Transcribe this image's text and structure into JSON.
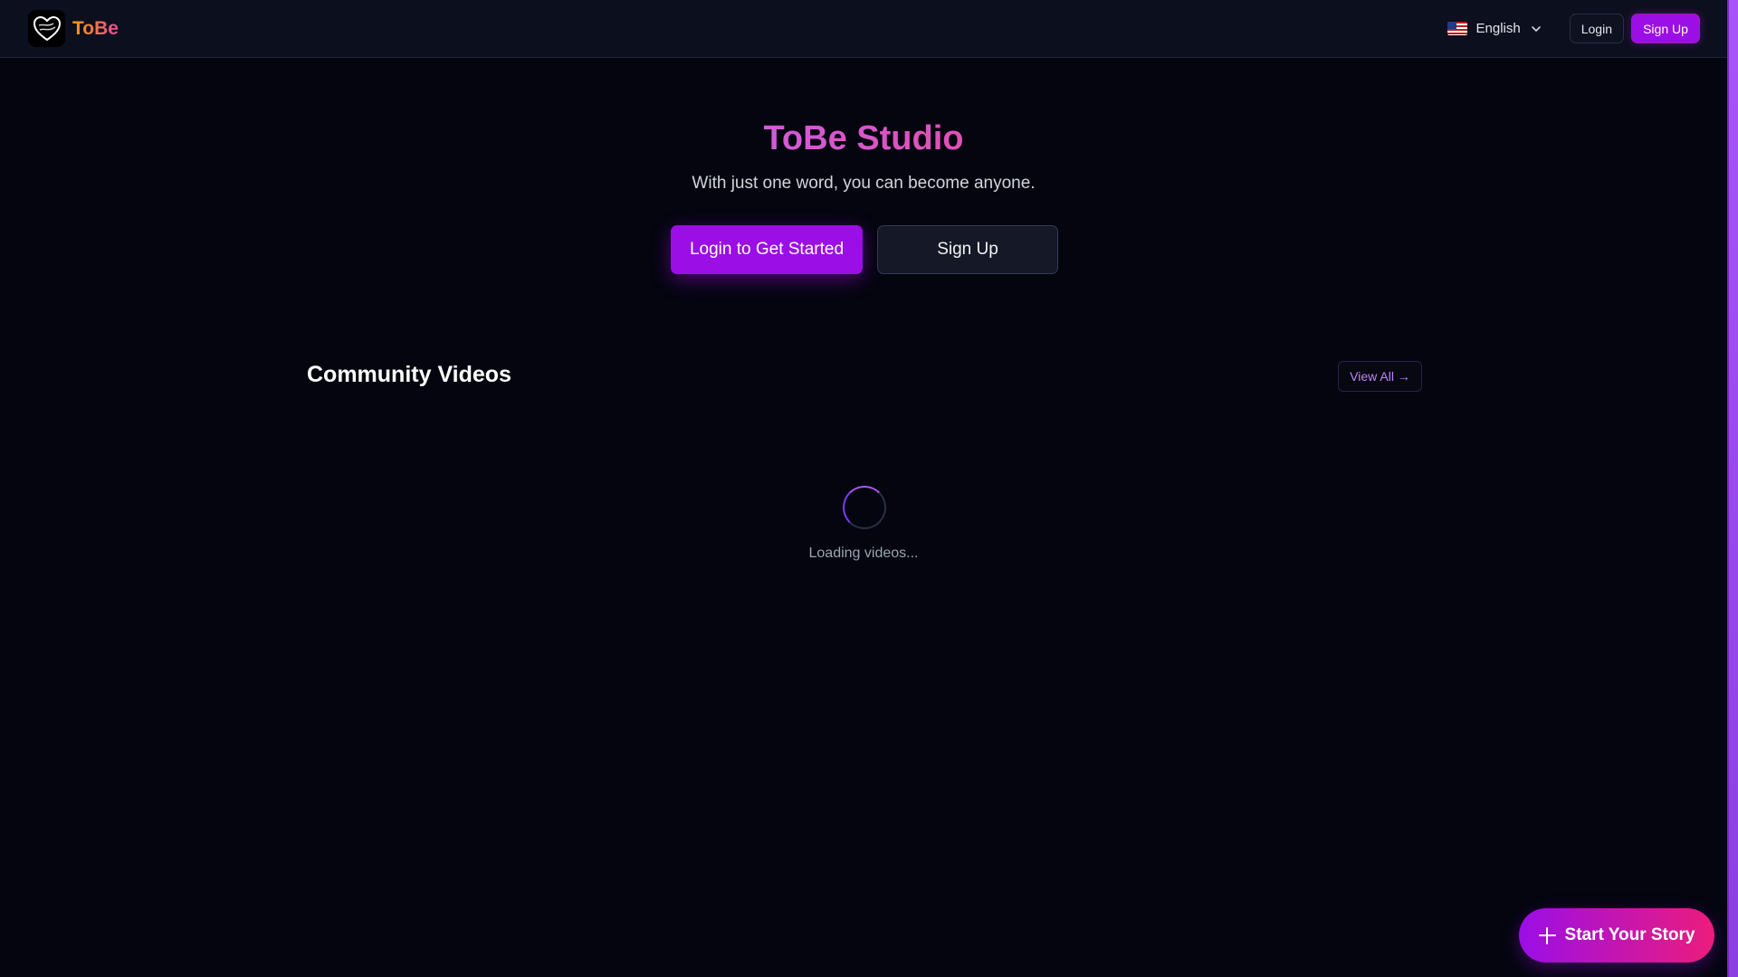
{
  "nav": {
    "brand": "ToBe",
    "language": "English",
    "login": "Login",
    "signup": "Sign Up"
  },
  "hero": {
    "title": "ToBe Studio",
    "subtitle": "With just one word, you can become anyone.",
    "primary_cta": "Login to Get Started",
    "secondary_cta": "Sign Up"
  },
  "community": {
    "title": "Community Videos",
    "view_all": "View All →",
    "loading": "Loading videos..."
  },
  "fab": {
    "label": "Start Your Story"
  },
  "icons": {
    "logo": "heart-logo-icon",
    "flag": "us-flag-icon",
    "dropdown": "chevron-down-icon",
    "spinner": "loading-spinner-icon",
    "fab": "plus-icon"
  },
  "colors": {
    "background": "#04050f",
    "nav_bg": "#0c0f1d",
    "accent_purple": "#9b0ee6",
    "accent_pink": "#ec4899",
    "scrollbar": "#a855f7"
  }
}
